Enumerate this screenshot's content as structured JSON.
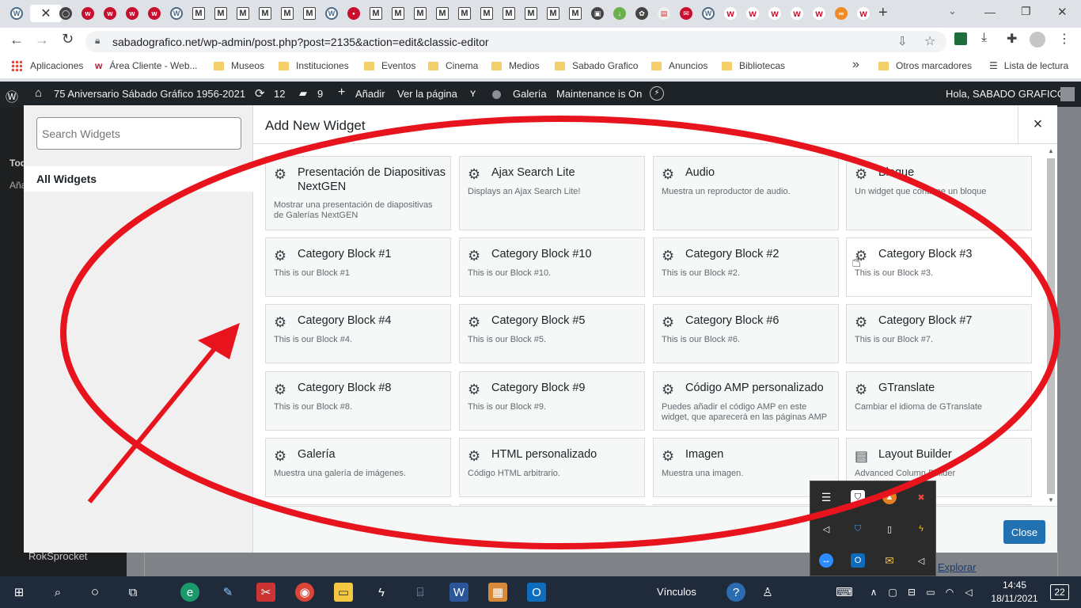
{
  "browser": {
    "url": "sabadografico.net/wp-admin/post.php?post=2135&action=edit&classic-editor",
    "new_tab": "+",
    "bookmarks": [
      "Aplicaciones",
      "Área Cliente - Web...",
      "Museos",
      "Instituciones",
      "Eventos",
      "Cinema",
      "Medios",
      "Sabado Grafico",
      "Anuncios",
      "Bibliotecas"
    ],
    "other_bookmarks": "Otros marcadores",
    "reading_list": "Lista de lectura",
    "more": "»"
  },
  "adminbar": {
    "site": "75 Aniversario Sábado Gráfico 1956-2021",
    "updates": "12",
    "comments": "9",
    "add": "Añadir",
    "view": "Ver la página",
    "gallery": "Galería",
    "maintenance": "Maintenance is On",
    "greeting": "Hola, SABADO GRAFICO"
  },
  "behind": {
    "side_a": "Tod",
    "side_b": "Aña",
    "side_c": "RokSprocket",
    "explore": "Explorar"
  },
  "modal": {
    "search_placeholder": "Search Widgets",
    "all_widgets": "All Widgets",
    "title": "Add New Widget",
    "close_x": "×",
    "close_button": "Close",
    "widgets": [
      {
        "title": "Presentación de Diapositivas NextGEN",
        "desc": "Mostrar una presentación de diapositivas de Galerías NextGEN",
        "icon": "gear-icon"
      },
      {
        "title": "Ajax Search Lite",
        "desc": "Displays an Ajax Search Lite!",
        "icon": "gear-icon"
      },
      {
        "title": "Audio",
        "desc": "Muestra un reproductor de audio.",
        "icon": "gear-icon"
      },
      {
        "title": "Bloque",
        "desc": "Un widget que contiene un bloque",
        "icon": "gear-icon"
      },
      {
        "title": "Category Block #1",
        "desc": "This is our Block #1",
        "icon": "gear-icon"
      },
      {
        "title": "Category Block #10",
        "desc": "This is our Block #10.",
        "icon": "gear-icon"
      },
      {
        "title": "Category Block #2",
        "desc": "This is our Block #2.",
        "icon": "gear-icon"
      },
      {
        "title": "Category Block #3",
        "desc": "This is our Block #3.",
        "icon": "gear-icon"
      },
      {
        "title": "Category Block #4",
        "desc": "This is our Block #4.",
        "icon": "gear-icon"
      },
      {
        "title": "Category Block #5",
        "desc": "This is our Block #5.",
        "icon": "gear-icon"
      },
      {
        "title": "Category Block #6",
        "desc": "This is our Block #6.",
        "icon": "gear-icon"
      },
      {
        "title": "Category Block #7",
        "desc": "This is our Block #7.",
        "icon": "gear-icon"
      },
      {
        "title": "Category Block #8",
        "desc": "This is our Block #8.",
        "icon": "gear-icon"
      },
      {
        "title": "Category Block #9",
        "desc": "This is our Block #9.",
        "icon": "gear-icon"
      },
      {
        "title": "Código AMP personalizado",
        "desc": "Puedes añadir el código AMP en este widget, que aparecerá en las páginas AMP",
        "icon": "gear-icon"
      },
      {
        "title": "GTranslate",
        "desc": "Cambiar el idioma de GTranslate",
        "icon": "gear-icon"
      },
      {
        "title": "Galería",
        "desc": "Muestra una galería de imágenes.",
        "icon": "gear-icon"
      },
      {
        "title": "HTML personalizado",
        "desc": "Código HTML arbitrario.",
        "icon": "gear-icon"
      },
      {
        "title": "Imagen",
        "desc": "Muestra una imagen.",
        "icon": "gear-icon"
      },
      {
        "title": "Layout Builder",
        "desc": "Advanced Column Builder",
        "icon": "layout-icon"
      }
    ]
  },
  "taskbar": {
    "links": "Vínculos",
    "time": "14:45",
    "date": "18/11/2021",
    "notifications": "22"
  },
  "colors": {
    "admin_bar": "#1d2327",
    "primary_button": "#2271b1",
    "annotation": "#e8141d",
    "taskbar": "#1f2a3a"
  }
}
